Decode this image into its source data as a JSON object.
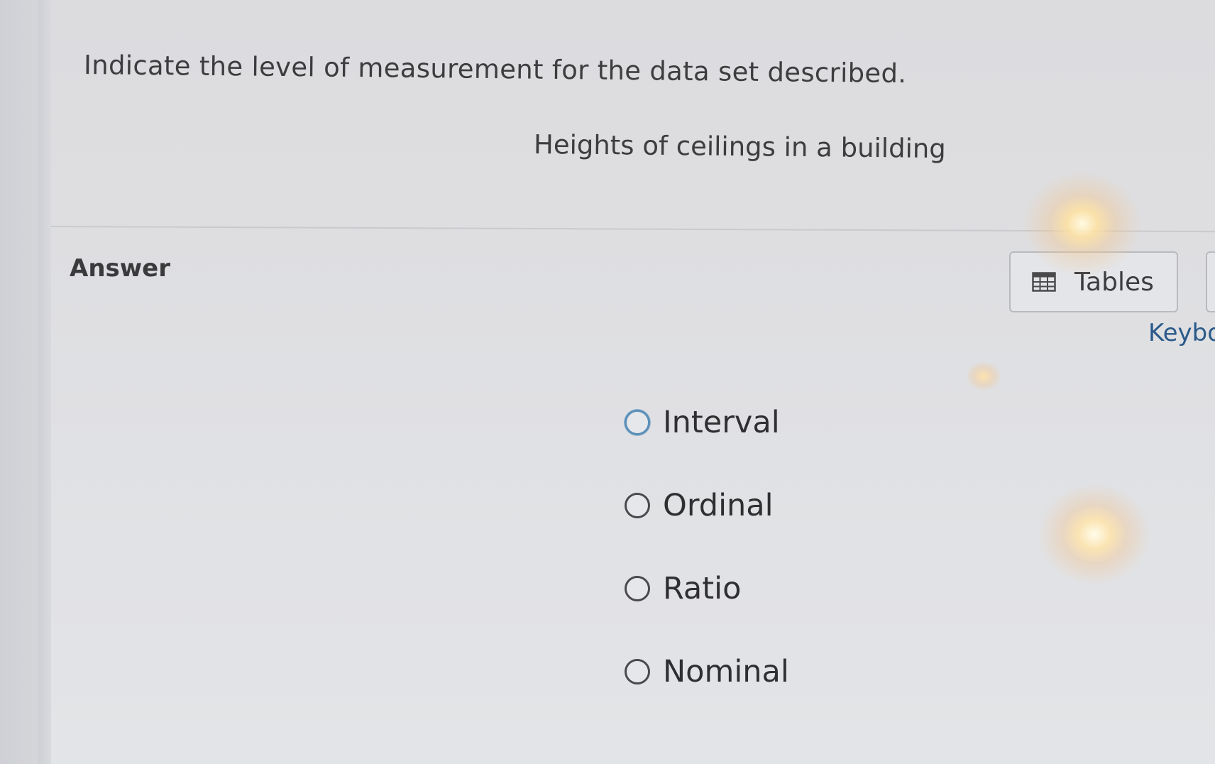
{
  "question": {
    "prompt": "Indicate the level of measurement for the data set described.",
    "dataset": "Heights of ceilings in a building"
  },
  "answer": {
    "label": "Answer"
  },
  "tools": {
    "tables_label": "Tables",
    "tables_icon": "table-grid-icon",
    "keyboard_label": "Keybo"
  },
  "options": [
    {
      "label": "Interval",
      "selected": false
    },
    {
      "label": "Ordinal",
      "selected": false
    },
    {
      "label": "Ratio",
      "selected": false
    },
    {
      "label": "Nominal",
      "selected": false
    }
  ],
  "colors": {
    "link": "#2a5a8a",
    "focus_ring": "#5b8fb8",
    "text": "#3d3d3f"
  }
}
